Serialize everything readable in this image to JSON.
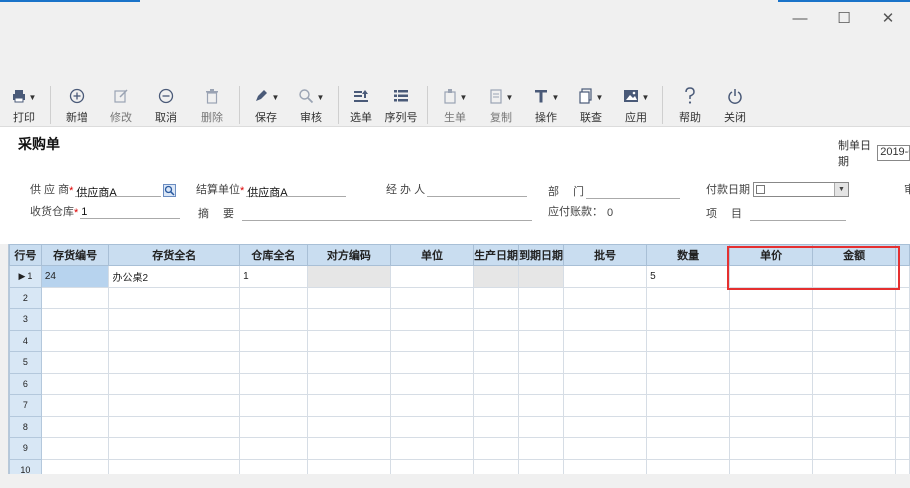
{
  "window": {
    "minimize": "—",
    "maximize": "☐",
    "close": "✕"
  },
  "toolbar": [
    {
      "key": "print",
      "label": "打印",
      "icon": "printer-icon",
      "dropdown": true,
      "enabled": true
    },
    {
      "key": "new",
      "label": "新增",
      "icon": "plus-circle-icon",
      "dropdown": false,
      "enabled": true
    },
    {
      "key": "edit",
      "label": "修改",
      "icon": "edit-icon",
      "dropdown": false,
      "enabled": false
    },
    {
      "key": "cancel",
      "label": "取消",
      "icon": "minus-circle-icon",
      "dropdown": false,
      "enabled": true
    },
    {
      "key": "delete",
      "label": "删除",
      "icon": "trash-icon",
      "dropdown": false,
      "enabled": false
    },
    {
      "key": "save",
      "label": "保存",
      "icon": "pen-icon",
      "dropdown": true,
      "enabled": true
    },
    {
      "key": "audit",
      "label": "审核",
      "icon": "magnifier-icon",
      "dropdown": true,
      "enabled": true
    },
    {
      "key": "select",
      "label": "选单",
      "icon": "select-list-icon",
      "dropdown": false,
      "enabled": true
    },
    {
      "key": "serial",
      "label": "序列号",
      "icon": "serial-list-icon",
      "dropdown": false,
      "enabled": true
    },
    {
      "key": "generate",
      "label": "生单",
      "icon": "generate-doc-icon",
      "dropdown": true,
      "enabled": false
    },
    {
      "key": "copy",
      "label": "复制",
      "icon": "copy-icon",
      "dropdown": true,
      "enabled": false
    },
    {
      "key": "operate",
      "label": "操作",
      "icon": "operate-icon",
      "dropdown": true,
      "enabled": true
    },
    {
      "key": "query",
      "label": "联查",
      "icon": "linked-query-icon",
      "dropdown": true,
      "enabled": true
    },
    {
      "key": "apply",
      "label": "应用",
      "icon": "image-icon",
      "dropdown": true,
      "enabled": true
    },
    {
      "key": "help",
      "label": "帮助",
      "icon": "question-icon",
      "dropdown": false,
      "enabled": true
    },
    {
      "key": "close",
      "label": "关闭",
      "icon": "power-icon",
      "dropdown": false,
      "enabled": true
    }
  ],
  "form": {
    "title": "采购单",
    "date_label": "制单日期",
    "date_value": "2019-0",
    "supplier_label": "供 应 商",
    "supplier_value": "供应商A",
    "settle_label": "结算单位",
    "settle_value": "供应商A",
    "handler_label": "经 办 人",
    "handler_value": "",
    "dept_label": "部　 门",
    "dept_value": "",
    "pay_date_label": "付款日期",
    "warehouse_label": "收货仓库",
    "warehouse_value": "1",
    "summary_label": "摘　 要",
    "summary_value": "",
    "payable_label": "应付账款：",
    "payable_value": "0",
    "item_label": "项　 目",
    "item_value": "",
    "edge_label": "审"
  },
  "grid": {
    "columns": [
      "行号",
      "存货编号",
      "存货全名",
      "仓库全名",
      "对方编码",
      "单位",
      "生产日期",
      "到期日期",
      "批号",
      "数量",
      "单价",
      "金额"
    ],
    "rows": [
      {
        "no": "1",
        "cells": [
          "24",
          "办公桌2",
          "1",
          "",
          "",
          "",
          "",
          "",
          "5",
          "",
          ""
        ]
      },
      {
        "no": "2",
        "cells": [
          "",
          "",
          "",
          "",
          "",
          "",
          "",
          "",
          "",
          "",
          ""
        ]
      },
      {
        "no": "3",
        "cells": [
          "",
          "",
          "",
          "",
          "",
          "",
          "",
          "",
          "",
          "",
          ""
        ]
      },
      {
        "no": "4",
        "cells": [
          "",
          "",
          "",
          "",
          "",
          "",
          "",
          "",
          "",
          "",
          ""
        ]
      },
      {
        "no": "5",
        "cells": [
          "",
          "",
          "",
          "",
          "",
          "",
          "",
          "",
          "",
          "",
          ""
        ]
      },
      {
        "no": "6",
        "cells": [
          "",
          "",
          "",
          "",
          "",
          "",
          "",
          "",
          "",
          "",
          ""
        ]
      },
      {
        "no": "7",
        "cells": [
          "",
          "",
          "",
          "",
          "",
          "",
          "",
          "",
          "",
          "",
          ""
        ]
      },
      {
        "no": "8",
        "cells": [
          "",
          "",
          "",
          "",
          "",
          "",
          "",
          "",
          "",
          "",
          ""
        ]
      },
      {
        "no": "9",
        "cells": [
          "",
          "",
          "",
          "",
          "",
          "",
          "",
          "",
          "",
          "",
          ""
        ]
      },
      {
        "no": "10",
        "cells": [
          "",
          "",
          "",
          "",
          "",
          "",
          "",
          "",
          "",
          "",
          ""
        ]
      }
    ],
    "current_row_marker": "▶"
  },
  "colors": {
    "header_bg": "#c9ddf0",
    "highlight": "#e53030",
    "required": "#dd0000"
  }
}
